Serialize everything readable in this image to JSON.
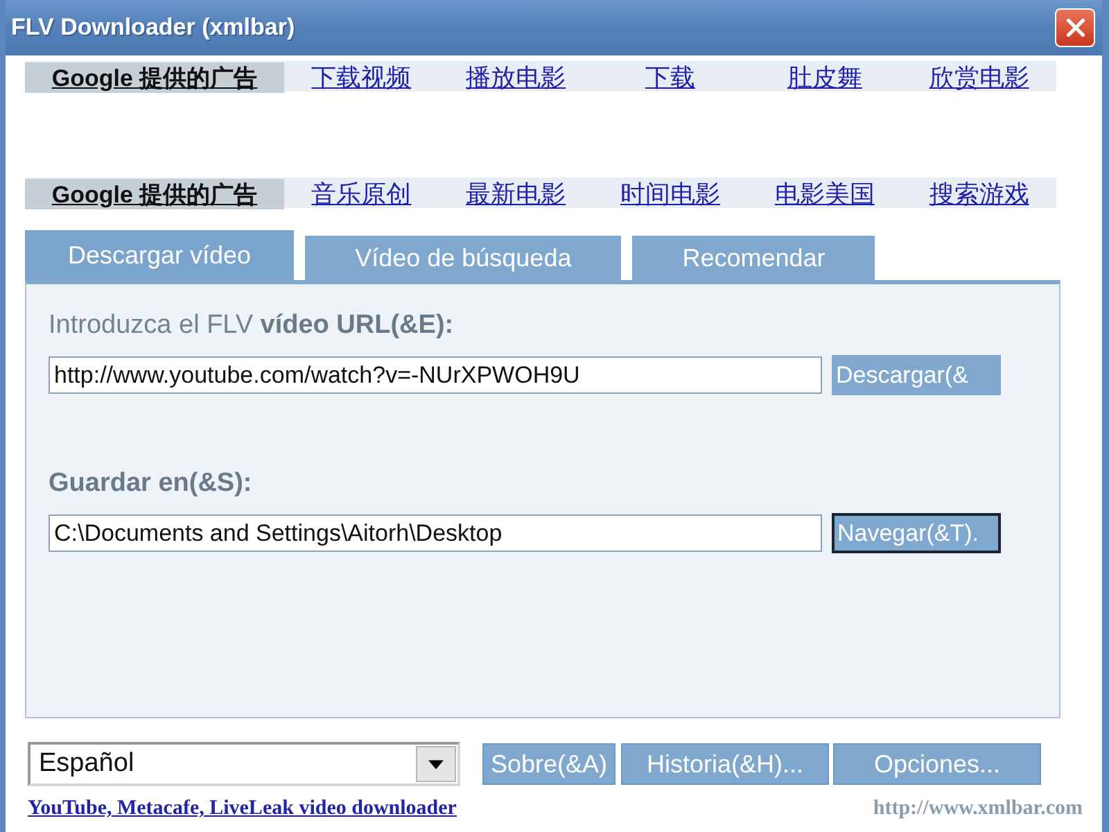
{
  "window": {
    "title": "FLV Downloader (xmlbar)"
  },
  "ad_bars": [
    {
      "label": "Google 提供的广告",
      "links": [
        "下载视频",
        "播放电影",
        "下载",
        "肚皮舞",
        "欣赏电影"
      ]
    },
    {
      "label": "Google 提供的广告",
      "links": [
        "音乐原创",
        "最新电影",
        "时间电影",
        "电影美国",
        "搜索游戏"
      ]
    }
  ],
  "tabs": [
    {
      "label": "Descargar vídeo",
      "selected": true
    },
    {
      "label": "Vídeo de búsqueda",
      "selected": false
    },
    {
      "label": "Recomendar",
      "selected": false
    }
  ],
  "fields": [
    {
      "label": "Introduzca el FLV **vídeo URL(&E):**",
      "value": "http://www.youtube.com/watch?v=-NUrXPWOH9U",
      "button": {
        "label": "Descargar(&",
        "focused": false
      }
    },
    {
      "label": "**Guardar en(&S):**",
      "value": "C:\\Documents and Settings\\Aitorh\\Desktop",
      "button": {
        "label": "Navegar(&T).",
        "focused": true
      }
    }
  ],
  "language_select": {
    "value": "Español"
  },
  "buttons": [
    "Sobre(&A)",
    "Historia(&H)...",
    "Opciones..."
  ],
  "footer": {
    "link": "YouTube, Metacafe, LiveLeak video downloader",
    "website": "http://www.xmlbar.com"
  }
}
